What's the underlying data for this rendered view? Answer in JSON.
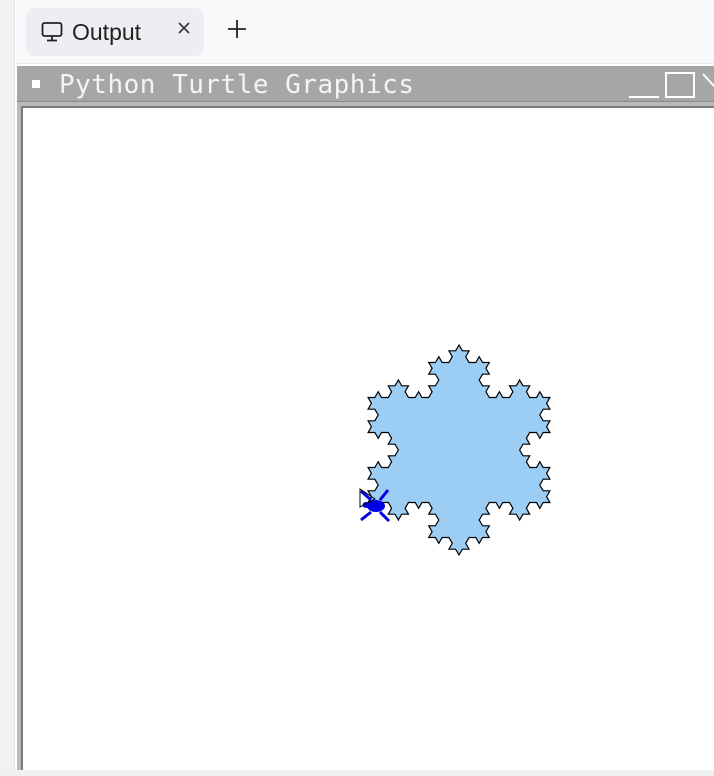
{
  "tabs": [
    {
      "label": "Output",
      "icon": "monitor-icon",
      "active": true
    }
  ],
  "new_tab_icon": "plus-icon",
  "window": {
    "title": "Python Turtle Graphics",
    "controls": [
      "minimize-icon",
      "maximize-icon",
      "close-icon"
    ]
  },
  "canvas": {
    "background": "#ffffff",
    "snowflake": {
      "shape": "koch-snowflake",
      "fill_color": "#9ccef5",
      "stroke_color": "#000000"
    },
    "turtle": {
      "color": "#0000e6",
      "shape": "turtle"
    }
  },
  "colors": {
    "titlebar": "#a6a6a6",
    "tab_bg": "#eceef1",
    "tabbar_bg": "#f7f8fa"
  }
}
